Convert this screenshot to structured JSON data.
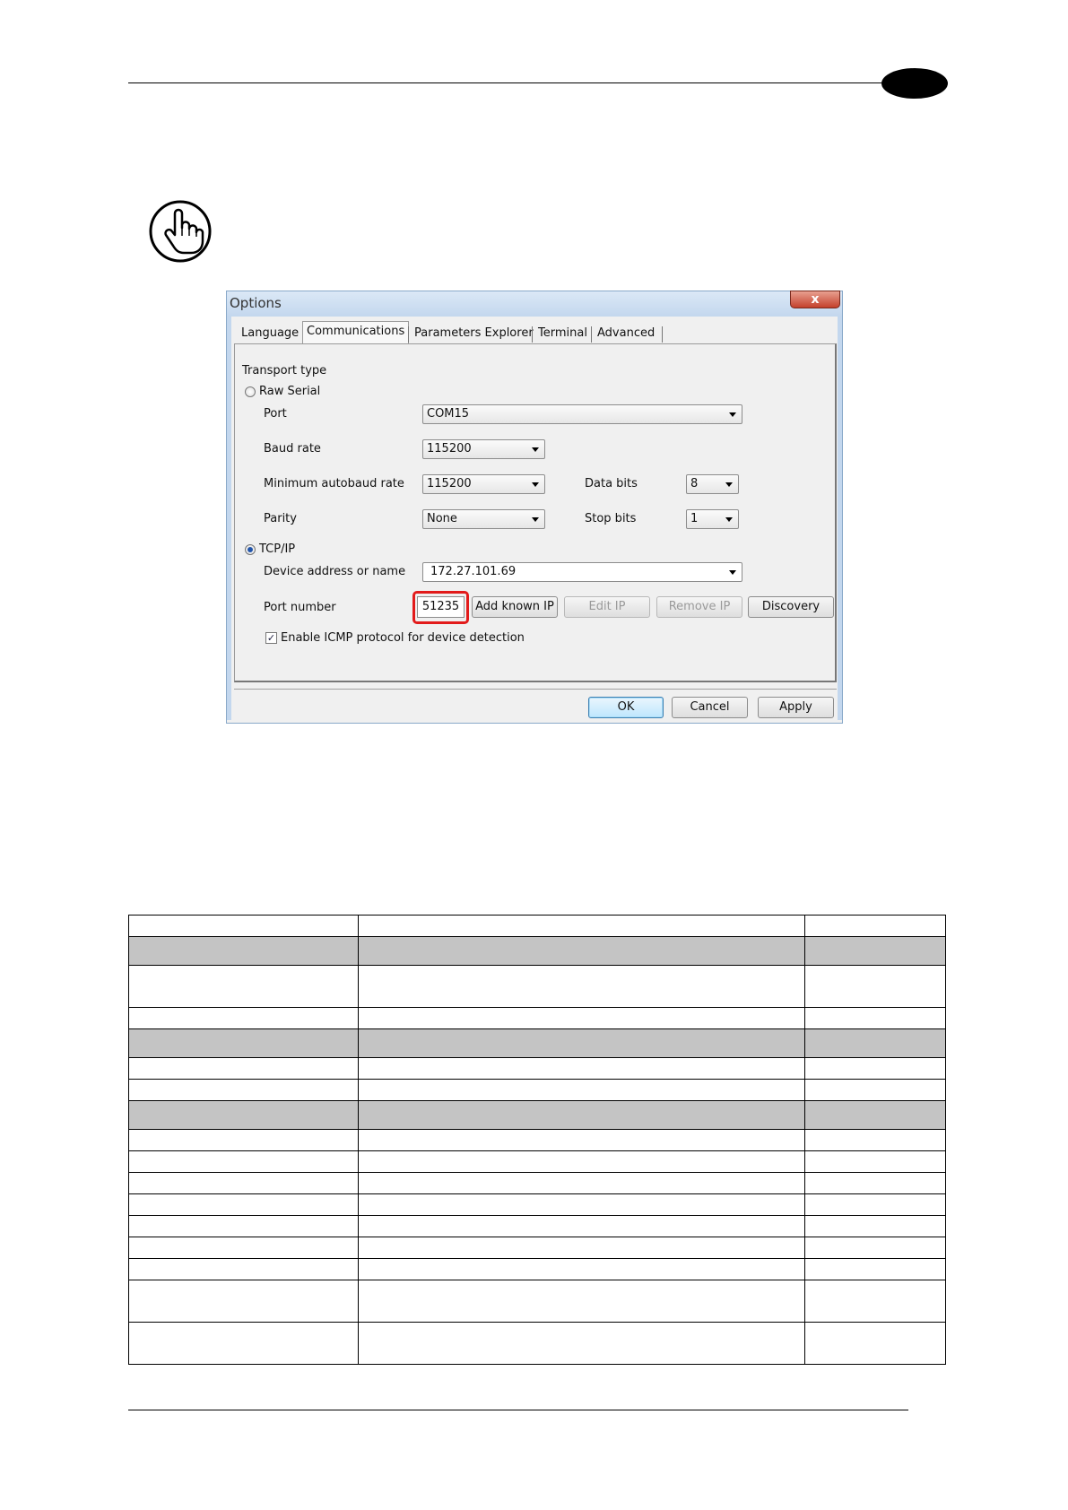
{
  "dialog": {
    "title": "Options",
    "close_glyph": "x",
    "tabs": [
      "Language",
      "Communications",
      "Parameters Explorer",
      "Terminal",
      "Advanced"
    ],
    "active_tab": "Communications",
    "transport_type_label": "Transport type",
    "raw_serial": {
      "label": "Raw Serial",
      "selected": false,
      "port_label": "Port",
      "port_value": "COM15",
      "baud_rate_label": "Baud rate",
      "baud_rate_value": "115200",
      "min_autobaud_label": "Minimum autobaud rate",
      "min_autobaud_value": "115200",
      "parity_label": "Parity",
      "parity_value": "None",
      "data_bits_label": "Data bits",
      "data_bits_value": "8",
      "stop_bits_label": "Stop bits",
      "stop_bits_value": "1"
    },
    "tcpip": {
      "label": "TCP/IP",
      "selected": true,
      "device_address_label": "Device address or name",
      "device_address_value": "172.27.101.69",
      "port_number_label": "Port number",
      "port_number_value": "51235",
      "add_known_ip": "Add known IP",
      "edit_ip": "Edit IP",
      "remove_ip": "Remove IP",
      "discovery": "Discovery"
    },
    "icmp_checkbox": {
      "label": "Enable ICMP protocol for device detection",
      "checked": true,
      "glyph": "✓"
    },
    "footer_buttons": {
      "ok": "OK",
      "cancel": "Cancel",
      "apply": "Apply"
    }
  },
  "table": {
    "rows": [
      {
        "shade": false,
        "tall": false
      },
      {
        "shade": true,
        "tall": false
      },
      {
        "shade": false,
        "tall": true
      },
      {
        "shade": false,
        "tall": false
      },
      {
        "shade": true,
        "tall": false
      },
      {
        "shade": false,
        "tall": false
      },
      {
        "shade": false,
        "tall": false
      },
      {
        "shade": true,
        "tall": false
      },
      {
        "shade": false,
        "tall": false
      },
      {
        "shade": false,
        "tall": false
      },
      {
        "shade": false,
        "tall": false
      },
      {
        "shade": false,
        "tall": false
      },
      {
        "shade": false,
        "tall": false
      },
      {
        "shade": false,
        "tall": false
      },
      {
        "shade": false,
        "tall": false
      },
      {
        "shade": false,
        "tall": true
      },
      {
        "shade": false,
        "tall": true
      }
    ]
  }
}
